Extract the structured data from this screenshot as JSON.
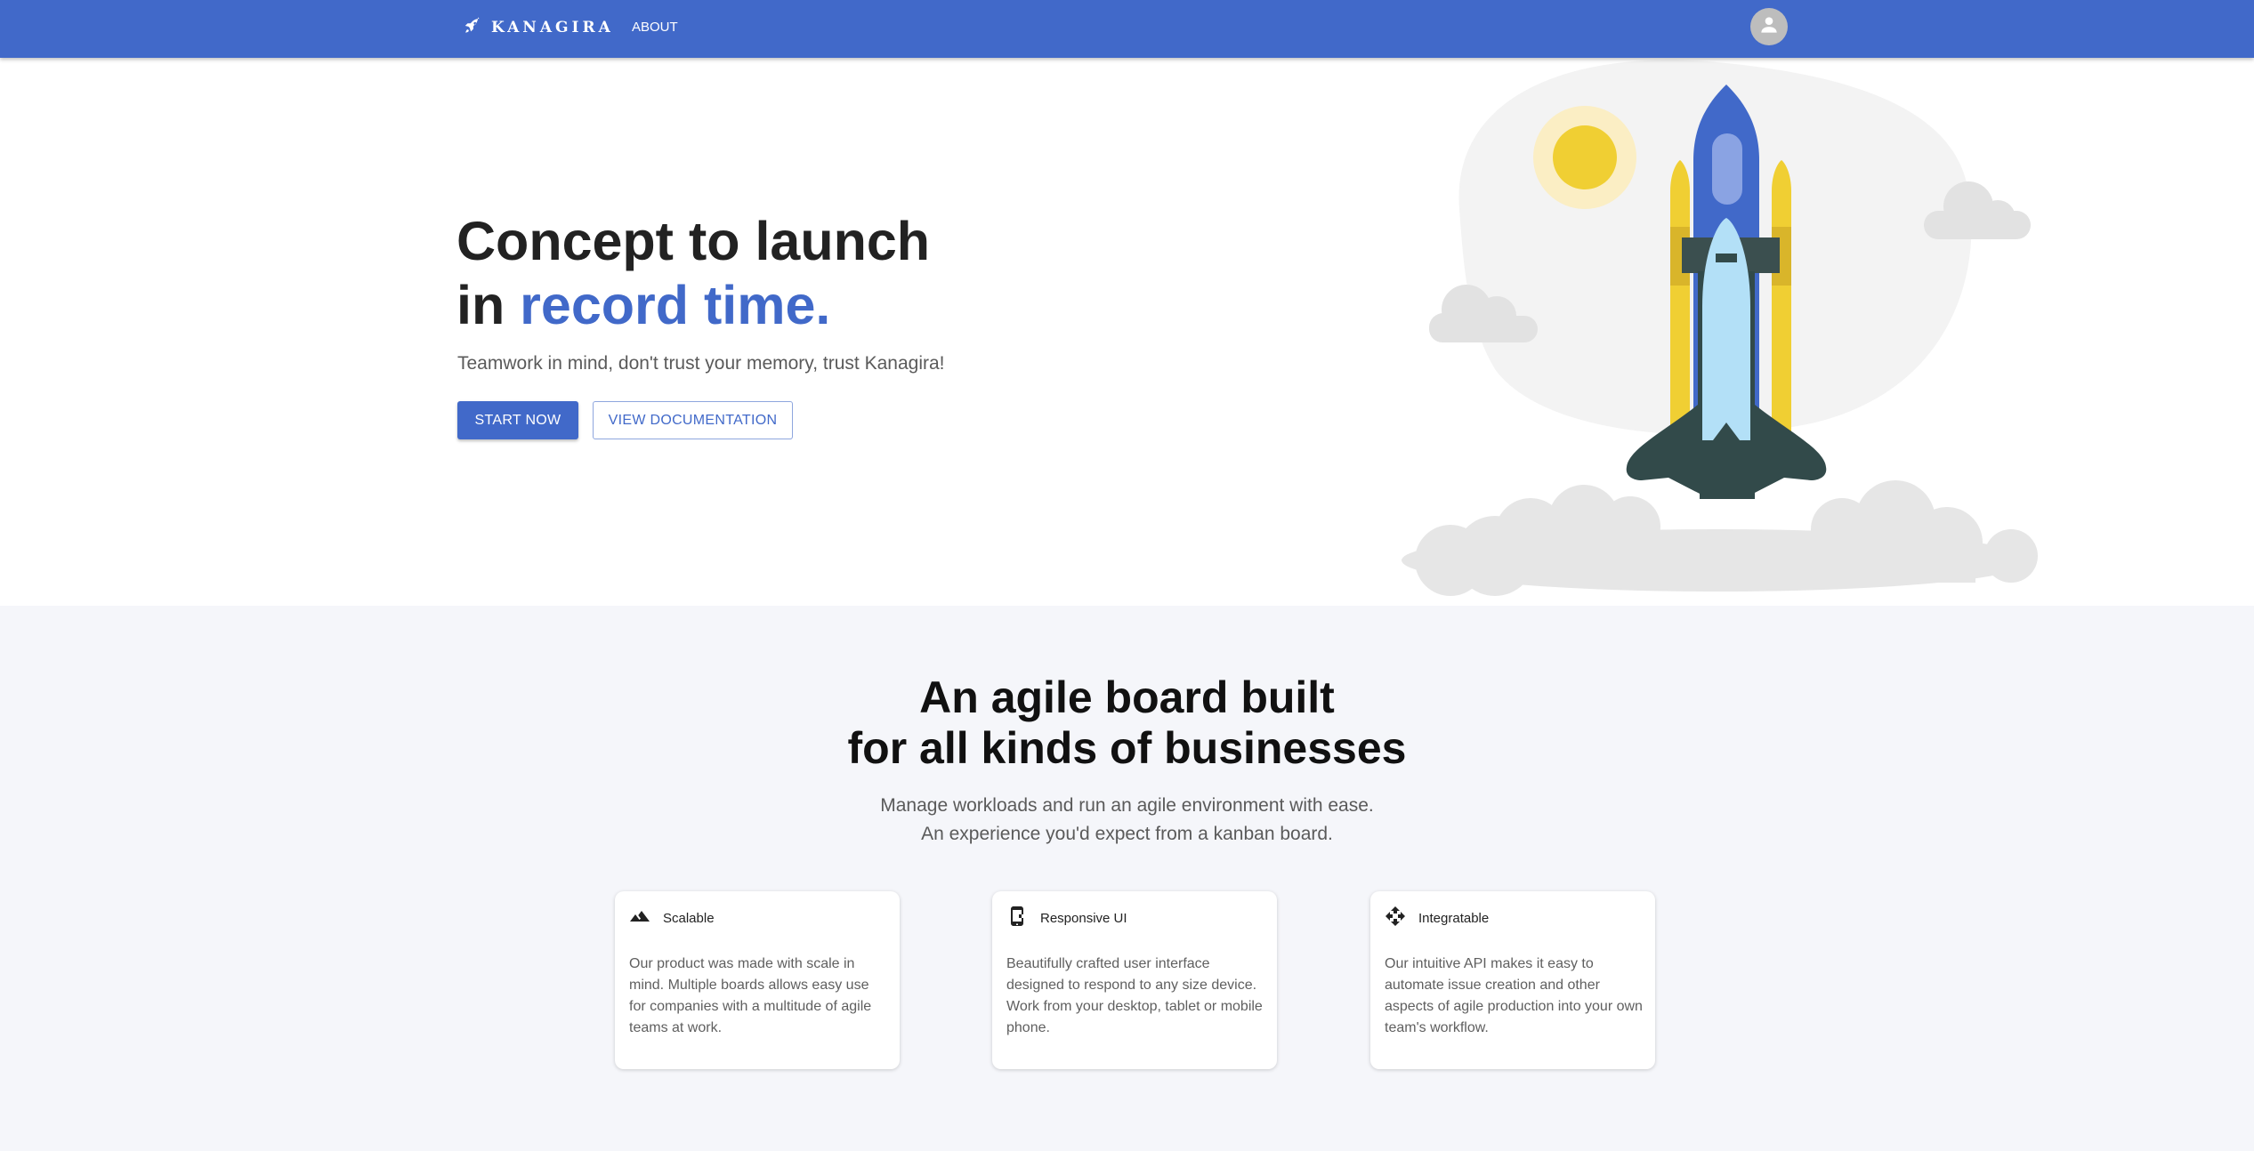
{
  "header": {
    "brand": "KANAGIRA",
    "nav_about": "ABOUT",
    "icons": {
      "logo": "rocket-icon",
      "avatar": "account-circle-icon"
    },
    "colors": {
      "bar": "#4169c9"
    }
  },
  "hero": {
    "title_line1": "Concept to launch",
    "title_in": "in ",
    "title_accent": "record time.",
    "subtitle": "Teamwork in mind, don't trust your memory, trust Kanagira!",
    "start_button": "START NOW",
    "docs_button": "VIEW DOCUMENTATION",
    "accent_color": "#4169c9"
  },
  "features": {
    "title_line1": "An agile board built",
    "title_line2": "for all kinds of businesses",
    "subtitle_line1": "Manage workloads and run an agile environment with ease.",
    "subtitle_line2": "An experience you'd expect from a kanban board.",
    "cards": [
      {
        "icon": "landscape-icon",
        "title": "Scalable",
        "body": "Our product was made with scale in mind. Multiple boards allows easy use for companies with a multitude of agile teams at work."
      },
      {
        "icon": "mobile-phone-icon",
        "title": "Responsive UI",
        "body": "Beautifully crafted user interface designed to respond to any size device. Work from your desktop, tablet or mobile phone."
      },
      {
        "icon": "move-arrows-icon",
        "title": "Integratable",
        "body": "Our intuitive API makes it easy to automate issue creation and other aspects of agile production into your own team's workflow."
      }
    ]
  }
}
